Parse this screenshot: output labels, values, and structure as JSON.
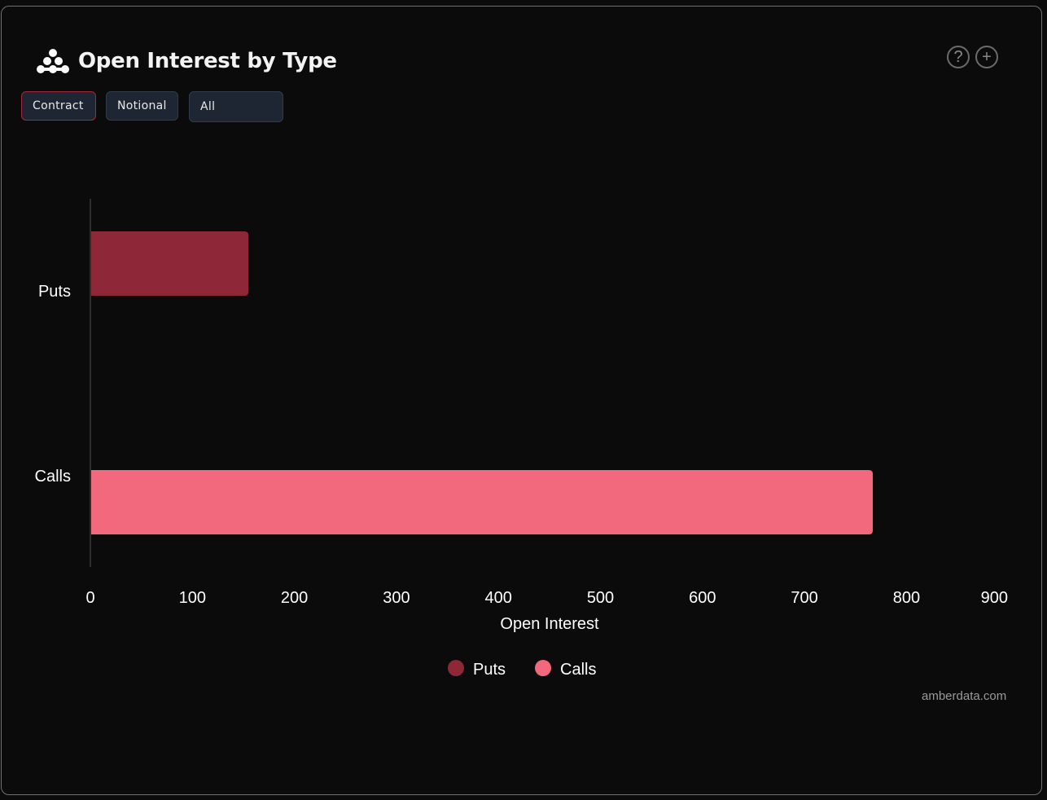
{
  "header": {
    "title": "Open Interest by Type",
    "logo_icon": "amberdata-logo-icon",
    "help_icon": "question-circle-icon",
    "add_icon": "plus-circle-icon"
  },
  "toolbar": {
    "buttons": [
      {
        "label": "Contract",
        "active": true
      },
      {
        "label": "Notional",
        "active": false
      }
    ],
    "select_value": "All"
  },
  "footer": {
    "watermark": "amberdata.com"
  },
  "colors": {
    "puts": "#8e2737",
    "calls": "#f2697e",
    "accent_border": "#a4293a"
  },
  "chart_data": {
    "type": "bar",
    "orientation": "horizontal",
    "title": "Open Interest by Type",
    "categories": [
      "Puts",
      "Calls"
    ],
    "values": [
      155,
      767
    ],
    "series": [
      {
        "name": "Puts",
        "values": [
          155,
          null
        ],
        "color": "#8e2737"
      },
      {
        "name": "Calls",
        "values": [
          null,
          767
        ],
        "color": "#f2697e"
      }
    ],
    "xlabel": "Open Interest",
    "ylabel": "",
    "xlim": [
      0,
      900
    ],
    "xticks": [
      0,
      100,
      200,
      300,
      400,
      500,
      600,
      700,
      800,
      900
    ],
    "grid": false,
    "legend": {
      "position": "bottom-center",
      "entries": [
        "Puts",
        "Calls"
      ]
    }
  }
}
